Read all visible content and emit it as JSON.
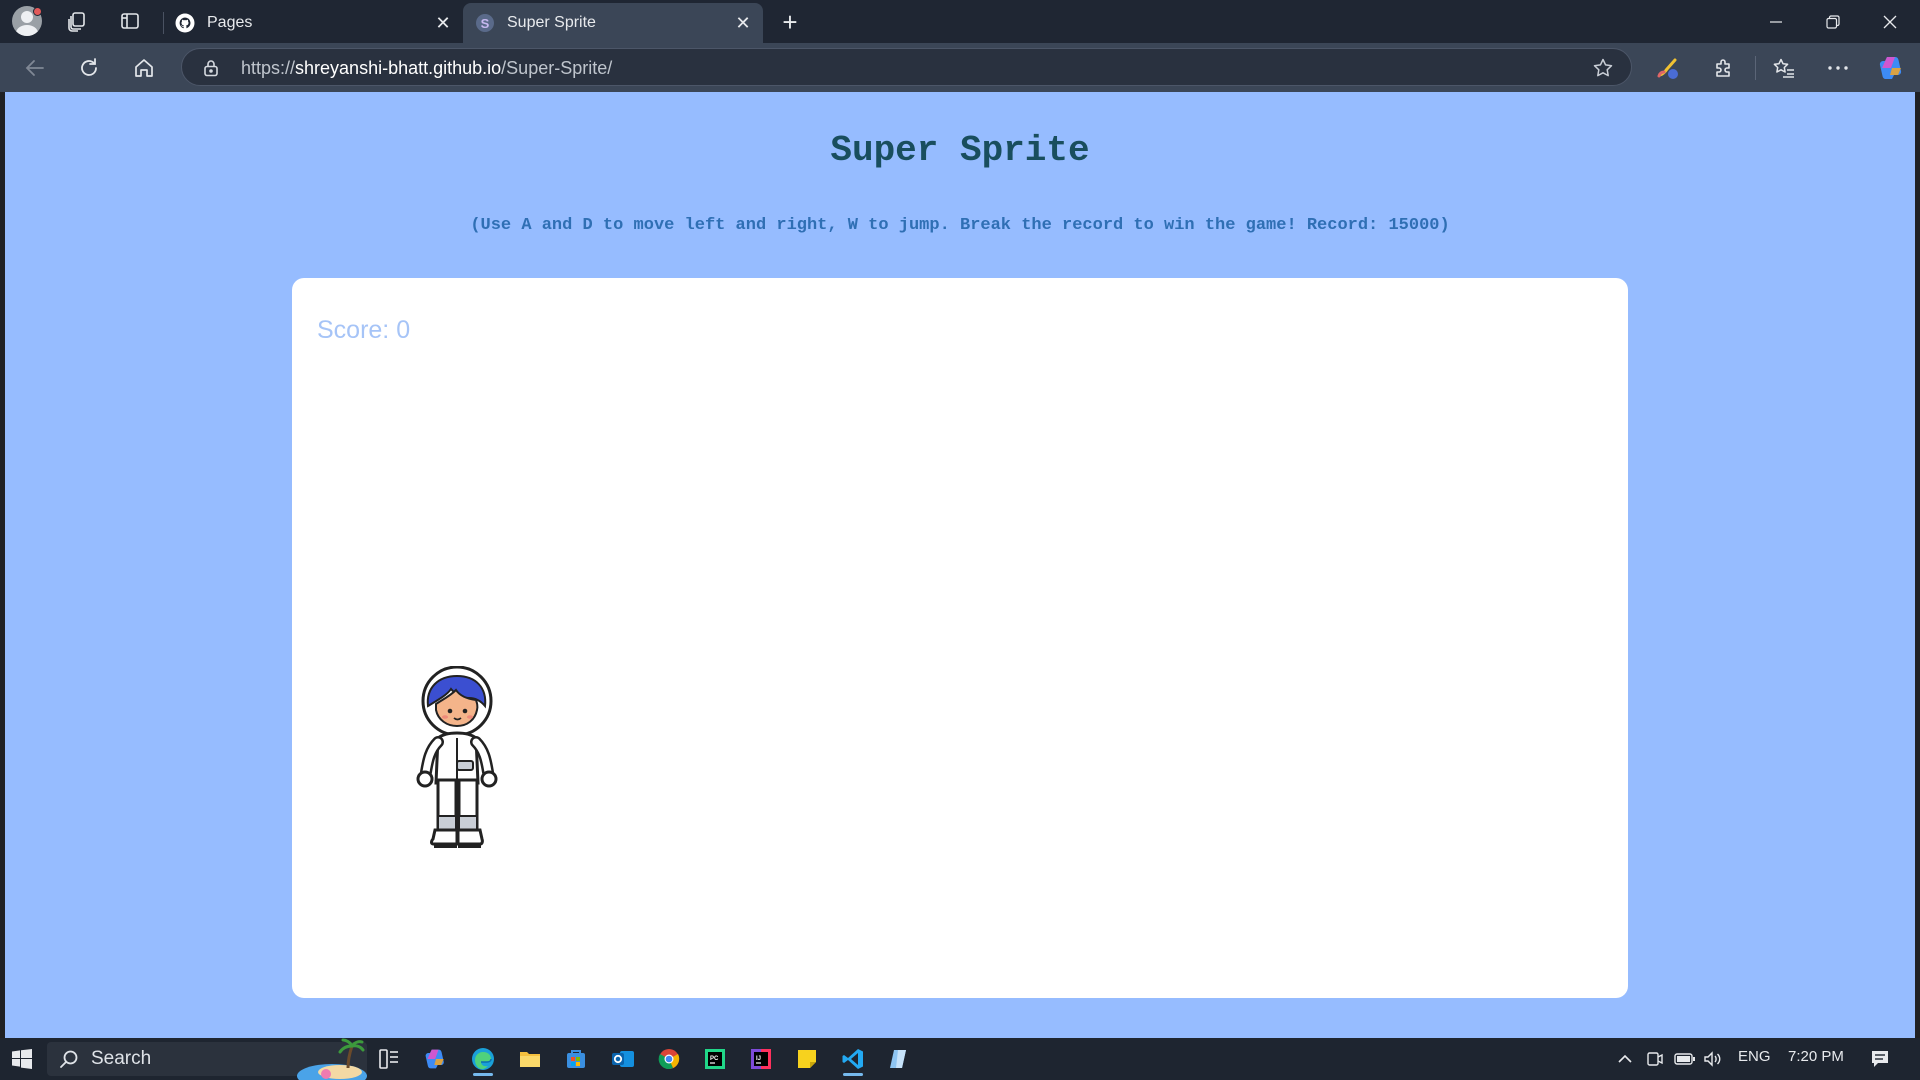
{
  "browser": {
    "tabs": [
      {
        "title": "Pages",
        "favicon": "github-icon"
      },
      {
        "title": "Super Sprite",
        "favicon": "super-sprite-icon"
      }
    ],
    "new_tab_label": "+",
    "url_scheme": "https://",
    "url_host": "shreyanshi-bhatt.github.io",
    "url_path": "/Super-Sprite/"
  },
  "page": {
    "title": "Super Sprite",
    "instructions": "(Use A and D to move left and right, W to jump. Break the record to win the game! Record: 15000)",
    "score_label": "Score: 0",
    "background_color": "#96bcff",
    "title_color": "#194e5e",
    "instruction_color": "#2f6fb4",
    "score_color": "#a6c4f7"
  },
  "taskbar": {
    "search_placeholder": "Search",
    "language": "ENG",
    "time": "7:20 PM"
  }
}
